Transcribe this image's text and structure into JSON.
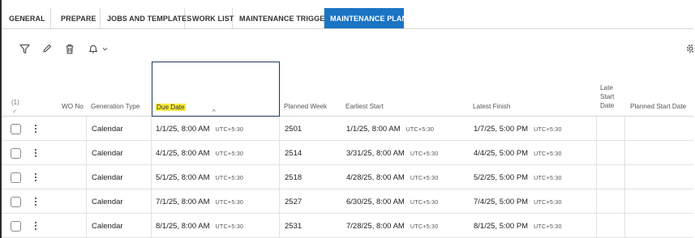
{
  "tabs": [
    {
      "label": "GENERAL",
      "active": false
    },
    {
      "label": "PREPARE",
      "active": false
    },
    {
      "label": "JOBS AND TEMPLATES",
      "active": false
    },
    {
      "label": "WORK LIST",
      "active": false
    },
    {
      "label": "MAINTENANCE TRIGGERS",
      "active": false
    },
    {
      "label": "MAINTENANCE PLAN",
      "active": true
    }
  ],
  "toolbar": {
    "icons": [
      "filter-icon",
      "edit-icon",
      "delete-icon",
      "bell-icon",
      "gear-icon"
    ]
  },
  "grid": {
    "selection_count": "(1)",
    "select_all_check": "✓",
    "columns": {
      "wo_no": "WO No",
      "generation_type": "Generation Type",
      "due_date": "Due Date",
      "planned_week": "Planned Week",
      "earliest_start": "Earliest Start",
      "latest_finish": "Latest Finish",
      "late_start_date": "Late Start Date",
      "planned_start_date": "Planned Start Date"
    },
    "sort_indicator": "^",
    "rows": [
      {
        "wo_no": "",
        "generation_type": "Calendar",
        "due_date": "1/1/25, 8:00 AM",
        "due_tz": "UTC+5:30",
        "planned_week": "2501",
        "earliest_start": "1/1/25, 8:00 AM",
        "es_tz": "UTC+5:30",
        "latest_finish": "1/7/25, 5:00 PM",
        "lf_tz": "UTC+5:30",
        "late_start_date": "",
        "planned_start_date": ""
      },
      {
        "wo_no": "",
        "generation_type": "Calendar",
        "due_date": "4/1/25, 8:00 AM",
        "due_tz": "UTC+5:30",
        "planned_week": "2514",
        "earliest_start": "3/31/25, 8:00 AM",
        "es_tz": "UTC+5:30",
        "latest_finish": "4/4/25, 5:00 PM",
        "lf_tz": "UTC+5:30",
        "late_start_date": "",
        "planned_start_date": ""
      },
      {
        "wo_no": "",
        "generation_type": "Calendar",
        "due_date": "5/1/25, 8:00 AM",
        "due_tz": "UTC+5:30",
        "planned_week": "2518",
        "earliest_start": "4/28/25, 8:00 AM",
        "es_tz": "UTC+5:30",
        "latest_finish": "5/2/25, 5:00 PM",
        "lf_tz": "UTC+5:30",
        "late_start_date": "",
        "planned_start_date": ""
      },
      {
        "wo_no": "",
        "generation_type": "Calendar",
        "due_date": "7/1/25, 8:00 AM",
        "due_tz": "UTC+5:30",
        "planned_week": "2527",
        "earliest_start": "6/30/25, 8:00 AM",
        "es_tz": "UTC+5:30",
        "latest_finish": "7/4/25, 5:00 PM",
        "lf_tz": "UTC+5:30",
        "late_start_date": "",
        "planned_start_date": ""
      },
      {
        "wo_no": "",
        "generation_type": "Calendar",
        "due_date": "8/1/25, 8:00 AM",
        "due_tz": "UTC+5:30",
        "planned_week": "2531",
        "earliest_start": "7/28/25, 8:00 AM",
        "es_tz": "UTC+5:30",
        "latest_finish": "8/1/25, 5:00 PM",
        "lf_tz": "UTC+5:30",
        "late_start_date": "",
        "planned_start_date": ""
      }
    ]
  },
  "colors": {
    "active_tab": "#1a74c4",
    "highlight": "#f7ea3a",
    "focus_border": "#23395b"
  }
}
